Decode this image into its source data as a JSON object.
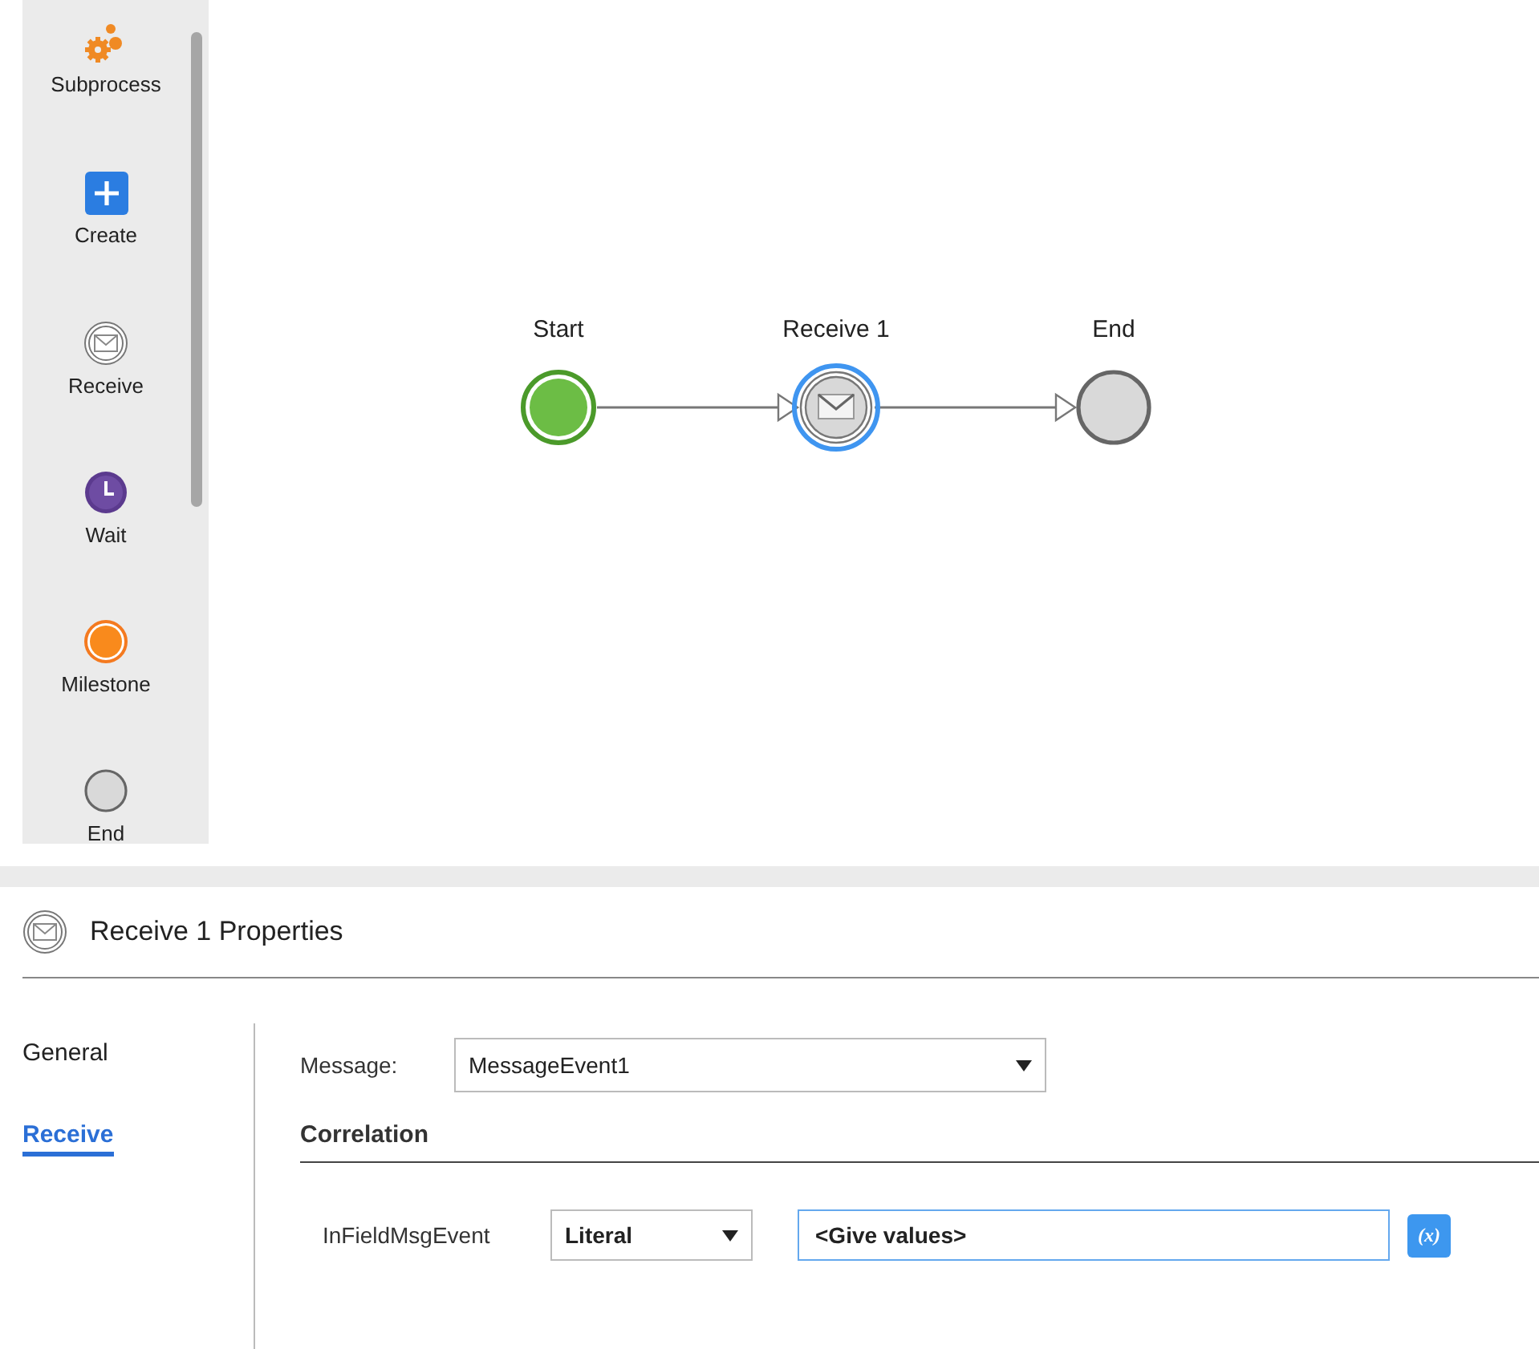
{
  "palette": {
    "items": [
      {
        "kind": "subprocess",
        "label": "Subprocess"
      },
      {
        "kind": "create",
        "label": "Create"
      },
      {
        "kind": "receive",
        "label": "Receive"
      },
      {
        "kind": "wait",
        "label": "Wait"
      },
      {
        "kind": "milestone",
        "label": "Milestone"
      },
      {
        "kind": "end",
        "label": "End"
      }
    ]
  },
  "canvas": {
    "nodes": [
      {
        "kind": "start",
        "label": "Start",
        "selected": false
      },
      {
        "kind": "receive",
        "label": "Receive 1",
        "selected": true
      },
      {
        "kind": "end",
        "label": "End",
        "selected": false
      }
    ]
  },
  "properties": {
    "title": "Receive 1 Properties",
    "tabs": [
      {
        "label": "General",
        "selected": false
      },
      {
        "label": "Receive",
        "selected": true
      }
    ],
    "message": {
      "label": "Message:",
      "value": "MessageEvent1"
    },
    "correlation": {
      "heading": "Correlation",
      "rows": [
        {
          "name": "InFieldMsgEvent",
          "type": "Literal",
          "value": "<Give values>",
          "focused": true,
          "expression_button": "(x)"
        }
      ]
    }
  }
}
